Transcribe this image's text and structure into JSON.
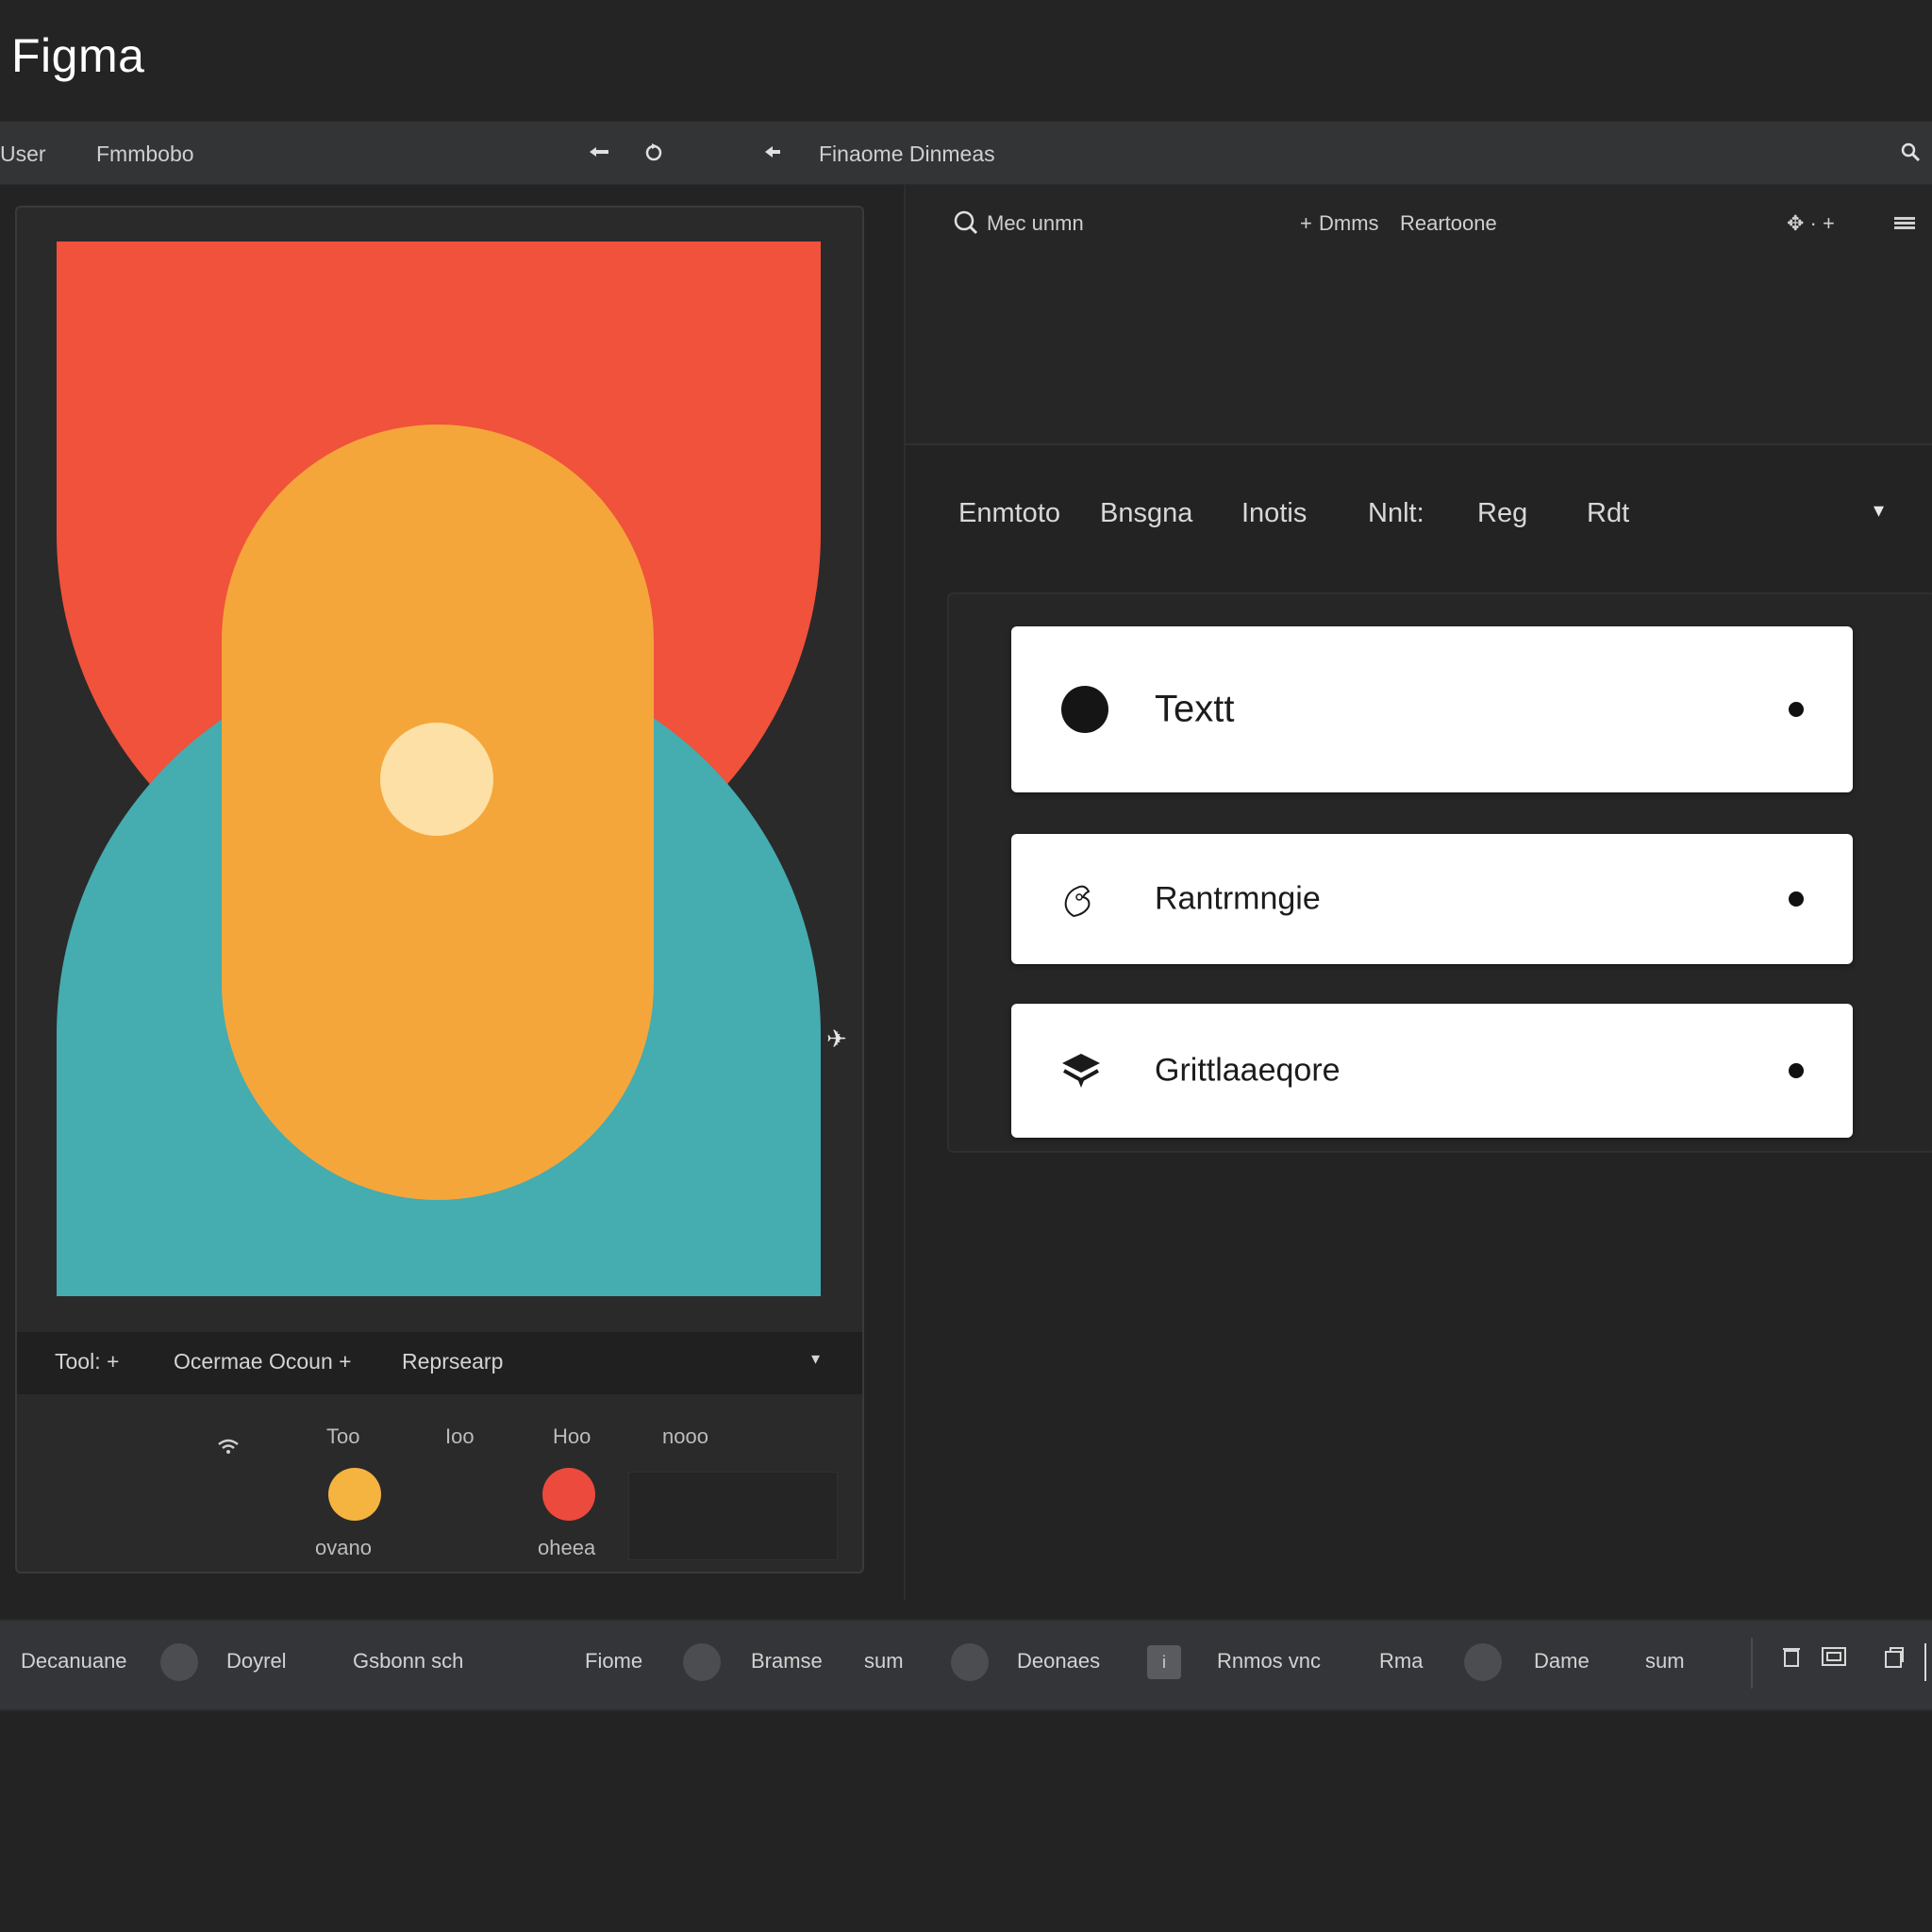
{
  "app": {
    "title": "Figma"
  },
  "toolbar": {
    "left_labels": [
      "User",
      "Fmmbobo"
    ],
    "center_label": "Finaome Dinmeas",
    "icons": [
      "back-arrow-icon",
      "rotate-icon",
      "pointer-icon",
      "search-icon"
    ]
  },
  "colors": {
    "red": "#F0523B",
    "orange": "#F5A63B",
    "teal": "#45ACB0",
    "light": "#FCE0A6",
    "background": "#232323"
  },
  "canvas_toolbar": {
    "items": [
      "Tool: +",
      "Ocermae Ocoun +",
      "Reprsearp"
    ],
    "chevron": "chevron-down-icon"
  },
  "swatches": {
    "headers": [
      "Too",
      "Ioo",
      "Hoo",
      "nooo"
    ],
    "items": [
      {
        "label": "ovano",
        "color": "#F5B33F"
      },
      {
        "label": "oheea",
        "color": "#EC4A3C"
      }
    ]
  },
  "right_top": {
    "search_label": "Mec unmn",
    "middle_labels": [
      "Dmms",
      "Reartoone"
    ],
    "icons": [
      "cursor-icon",
      "menu-icon"
    ]
  },
  "tabs": [
    "Enmtoto",
    "Bnsgna",
    "Inotis",
    "Nnlt:",
    "Reg",
    "Rdt"
  ],
  "list": [
    {
      "label": "Textt",
      "icon": "circle-icon"
    },
    {
      "label": "Rantrmngie",
      "icon": "hand-icon"
    },
    {
      "label": "Grittlaaeqore",
      "icon": "layers-icon"
    }
  ],
  "statusbar": {
    "items": [
      "Decanuane",
      "Doyrel",
      "Gsbonn sch",
      "Fiome",
      "Bramse",
      "sum",
      "Deonaes",
      "Rnmos vnc",
      "Rma",
      "Dame",
      "sum"
    ]
  }
}
